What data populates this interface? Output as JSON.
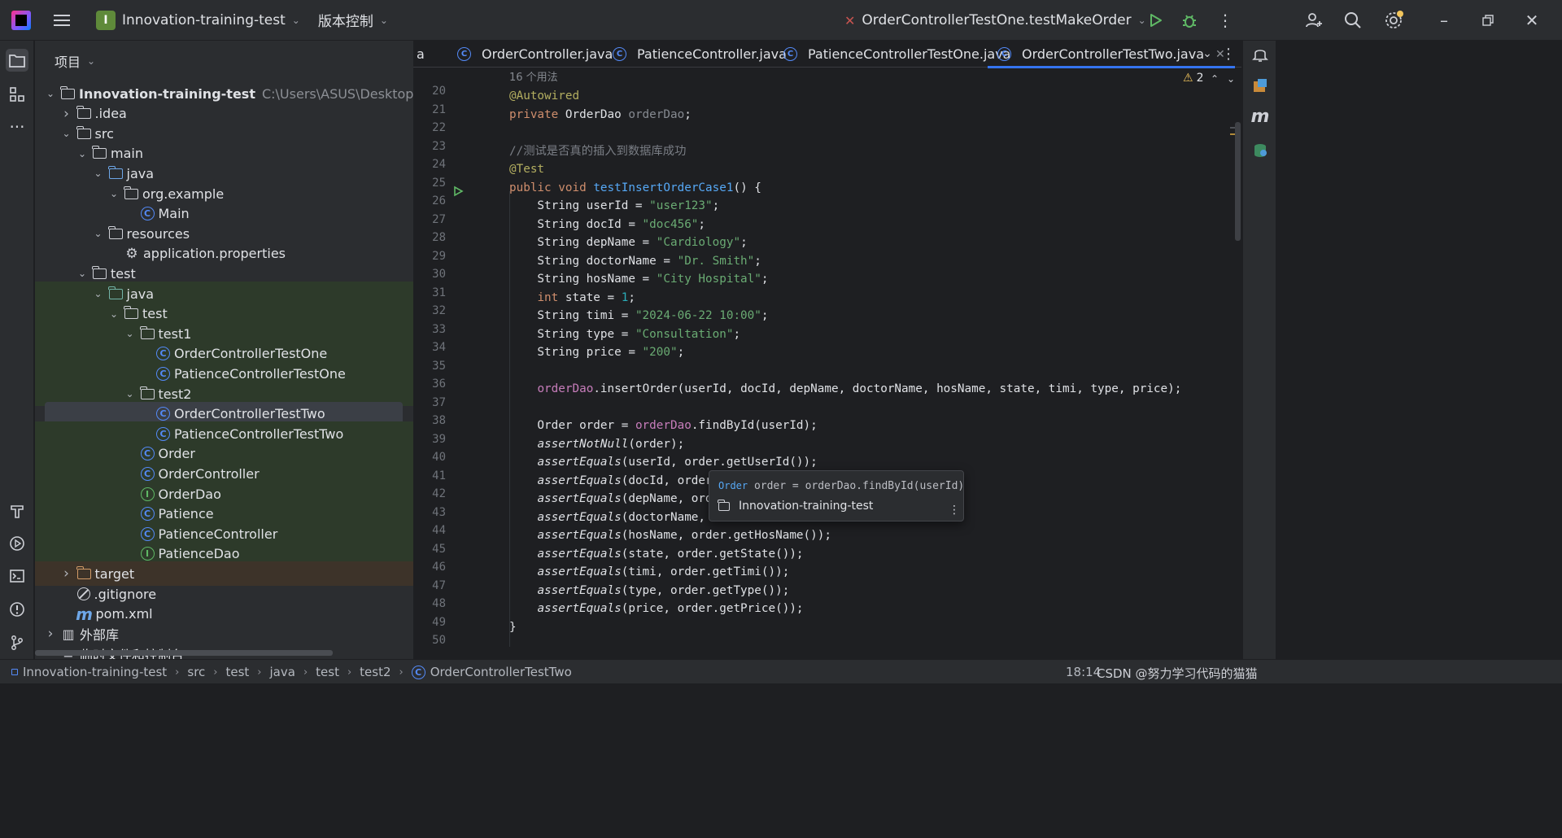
{
  "titlebar": {
    "project_badge": "I",
    "project_name": "Innovation-training-test",
    "vcs_label": "版本控制",
    "run_config": "OrderControllerTestOne.testMakeOrder"
  },
  "project_panel": {
    "title": "项目",
    "tree": [
      {
        "label": "Innovation-training-test",
        "bold": true,
        "path": "C:\\Users\\ASUS\\Desktop\\Innovation-t",
        "arrow": "down",
        "icon": "module-folder",
        "indent": 0
      },
      {
        "label": ".idea",
        "arrow": "right",
        "icon": "folder",
        "indent": 1
      },
      {
        "label": "src",
        "arrow": "down",
        "icon": "folder",
        "indent": 1
      },
      {
        "label": "main",
        "arrow": "down",
        "icon": "folder",
        "indent": 2
      },
      {
        "label": "java",
        "arrow": "down",
        "icon": "source-folder",
        "indent": 3
      },
      {
        "label": "org.example",
        "arrow": "down",
        "icon": "package",
        "indent": 4
      },
      {
        "label": "Main",
        "icon": "class",
        "indent": 5
      },
      {
        "label": "resources",
        "arrow": "down",
        "icon": "resource-folder",
        "indent": 3
      },
      {
        "label": "application.properties",
        "icon": "gear",
        "indent": 4
      },
      {
        "label": "test",
        "arrow": "down",
        "icon": "folder",
        "indent": 2
      },
      {
        "label": "java",
        "arrow": "down",
        "icon": "test-folder",
        "indent": 3,
        "green": true
      },
      {
        "label": "test",
        "arrow": "down",
        "icon": "package",
        "indent": 4,
        "green": true
      },
      {
        "label": "test1",
        "arrow": "down",
        "icon": "package",
        "indent": 5,
        "green": true
      },
      {
        "label": "OrderControllerTestOne",
        "icon": "class",
        "indent": 6,
        "green": true
      },
      {
        "label": "PatienceControllerTestOne",
        "icon": "class",
        "indent": 6,
        "green": true
      },
      {
        "label": "test2",
        "arrow": "down",
        "icon": "package",
        "indent": 5,
        "green": true
      },
      {
        "label": "OrderControllerTestTwo",
        "icon": "class",
        "indent": 6,
        "selected": true
      },
      {
        "label": "PatienceControllerTestTwo",
        "icon": "class",
        "indent": 6,
        "green": true
      },
      {
        "label": "Order",
        "icon": "class",
        "indent": 5,
        "green": true
      },
      {
        "label": "OrderController",
        "icon": "class",
        "indent": 5,
        "green": true
      },
      {
        "label": "OrderDao",
        "icon": "interface",
        "indent": 5,
        "green": true
      },
      {
        "label": "Patience",
        "icon": "class",
        "indent": 5,
        "green": true
      },
      {
        "label": "PatienceController",
        "icon": "class",
        "indent": 5,
        "green": true
      },
      {
        "label": "PatienceDao",
        "icon": "interface",
        "indent": 5,
        "green": true
      },
      {
        "label": "target",
        "arrow": "right",
        "icon": "excluded-folder",
        "indent": 1,
        "orange": true
      },
      {
        "label": ".gitignore",
        "icon": "ignore",
        "indent": 1
      },
      {
        "label": "pom.xml",
        "icon": "maven",
        "indent": 1
      },
      {
        "label": "外部库",
        "arrow": "right",
        "icon": "library",
        "indent": 0
      },
      {
        "label": "临时文件和控制台",
        "icon": "scratch",
        "indent": 0
      }
    ]
  },
  "editor": {
    "tabs": [
      {
        "label": "a",
        "partial": true
      },
      {
        "label": "OrderController.java"
      },
      {
        "label": "PatienceController.java"
      },
      {
        "label": "PatienceControllerTestOne.java"
      },
      {
        "label": "OrderControllerTestTwo.java",
        "active": true
      }
    ],
    "warning_count": "2",
    "usages": "16 个用法",
    "line_numbers": [
      "20",
      "21",
      "22",
      "23",
      "24",
      "25",
      "26",
      "27",
      "28",
      "29",
      "30",
      "31",
      "32",
      "33",
      "34",
      "35",
      "36",
      "37",
      "38",
      "39",
      "40",
      "41",
      "42",
      "43",
      "44",
      "45",
      "46",
      "47",
      "48",
      "49",
      "50"
    ],
    "code_lines": [
      [
        {
          "t": "@Autowired",
          "c": "an"
        }
      ],
      [
        {
          "t": "private ",
          "c": "kw"
        },
        {
          "t": "OrderDao "
        },
        {
          "t": "orderDao",
          "c": "gray"
        },
        {
          "t": ";"
        }
      ],
      [],
      [
        {
          "t": "//测试是否真的插入到数据库成功",
          "c": "cm"
        }
      ],
      [
        {
          "t": "@Test",
          "c": "an"
        }
      ],
      [
        {
          "t": "public ",
          "c": "kw"
        },
        {
          "t": "void ",
          "c": "kw"
        },
        {
          "t": "testInsertOrderCase1",
          "c": "fn"
        },
        {
          "t": "() {"
        }
      ],
      [
        {
          "t": "    String userId = "
        },
        {
          "t": "\"user123\"",
          "c": "str"
        },
        {
          "t": ";"
        }
      ],
      [
        {
          "t": "    String docId = "
        },
        {
          "t": "\"doc456\"",
          "c": "str"
        },
        {
          "t": ";"
        }
      ],
      [
        {
          "t": "    String depName = "
        },
        {
          "t": "\"Cardiology\"",
          "c": "str"
        },
        {
          "t": ";"
        }
      ],
      [
        {
          "t": "    String doctorName = "
        },
        {
          "t": "\"Dr. Smith\"",
          "c": "str"
        },
        {
          "t": ";"
        }
      ],
      [
        {
          "t": "    String hosName = "
        },
        {
          "t": "\"City Hospital\"",
          "c": "str"
        },
        {
          "t": ";"
        }
      ],
      [
        {
          "t": "    "
        },
        {
          "t": "int ",
          "c": "kw"
        },
        {
          "t": "state = "
        },
        {
          "t": "1",
          "c": "num"
        },
        {
          "t": ";"
        }
      ],
      [
        {
          "t": "    String timi = "
        },
        {
          "t": "\"2024-06-22 10:00\"",
          "c": "str"
        },
        {
          "t": ";"
        }
      ],
      [
        {
          "t": "    String type = "
        },
        {
          "t": "\"Consultation\"",
          "c": "str"
        },
        {
          "t": ";"
        }
      ],
      [
        {
          "t": "    String price = "
        },
        {
          "t": "\"200\"",
          "c": "str"
        },
        {
          "t": ";"
        }
      ],
      [],
      [
        {
          "t": "    "
        },
        {
          "t": "orderDao",
          "c": "fld"
        },
        {
          "t": ".insertOrder(userId, docId, depName, doctorName, hosName, state, timi, type, price);"
        }
      ],
      [],
      [
        {
          "t": "    Order order = "
        },
        {
          "t": "orderDao",
          "c": "fld"
        },
        {
          "t": ".findById(userId);"
        }
      ],
      [
        {
          "t": "    "
        },
        {
          "t": "assertNotNull",
          "c": "it"
        },
        {
          "t": "(order);"
        }
      ],
      [
        {
          "t": "    "
        },
        {
          "t": "assertEquals",
          "c": "it"
        },
        {
          "t": "(userId, order.getUserId());"
        }
      ],
      [
        {
          "t": "    "
        },
        {
          "t": "assertEquals",
          "c": "it"
        },
        {
          "t": "(docId, order."
        }
      ],
      [
        {
          "t": "    "
        },
        {
          "t": "assertEquals",
          "c": "it"
        },
        {
          "t": "(depName, orde"
        }
      ],
      [
        {
          "t": "    "
        },
        {
          "t": "assertEquals",
          "c": "it"
        },
        {
          "t": "(doctorName, o"
        }
      ],
      [
        {
          "t": "    "
        },
        {
          "t": "assertEquals",
          "c": "it"
        },
        {
          "t": "(hosName, order.getHosName());"
        }
      ],
      [
        {
          "t": "    "
        },
        {
          "t": "assertEquals",
          "c": "it"
        },
        {
          "t": "(state, order.getState());"
        }
      ],
      [
        {
          "t": "    "
        },
        {
          "t": "assertEquals",
          "c": "it"
        },
        {
          "t": "(timi, order.getTimi());"
        }
      ],
      [
        {
          "t": "    "
        },
        {
          "t": "assertEquals",
          "c": "it"
        },
        {
          "t": "(type, order.getType());"
        }
      ],
      [
        {
          "t": "    "
        },
        {
          "t": "assertEquals",
          "c": "it"
        },
        {
          "t": "(price, order.getPrice());"
        }
      ],
      [
        {
          "t": "}"
        }
      ],
      []
    ],
    "popup": {
      "type": "Order",
      "code": " order = orderDao.findById(userId)",
      "project": "Innovation-training-test"
    }
  },
  "statusbar": {
    "breadcrumb": [
      "Innovation-training-test",
      "src",
      "test",
      "java",
      "test",
      "test2",
      "OrderControllerTestTwo"
    ],
    "caret": "18:14",
    "watermark": "CSDN @努力学习代码的猫猫"
  },
  "colors": {
    "accent": "#3574f0",
    "run_green": "#5fb865",
    "warning": "#f2c55c"
  }
}
